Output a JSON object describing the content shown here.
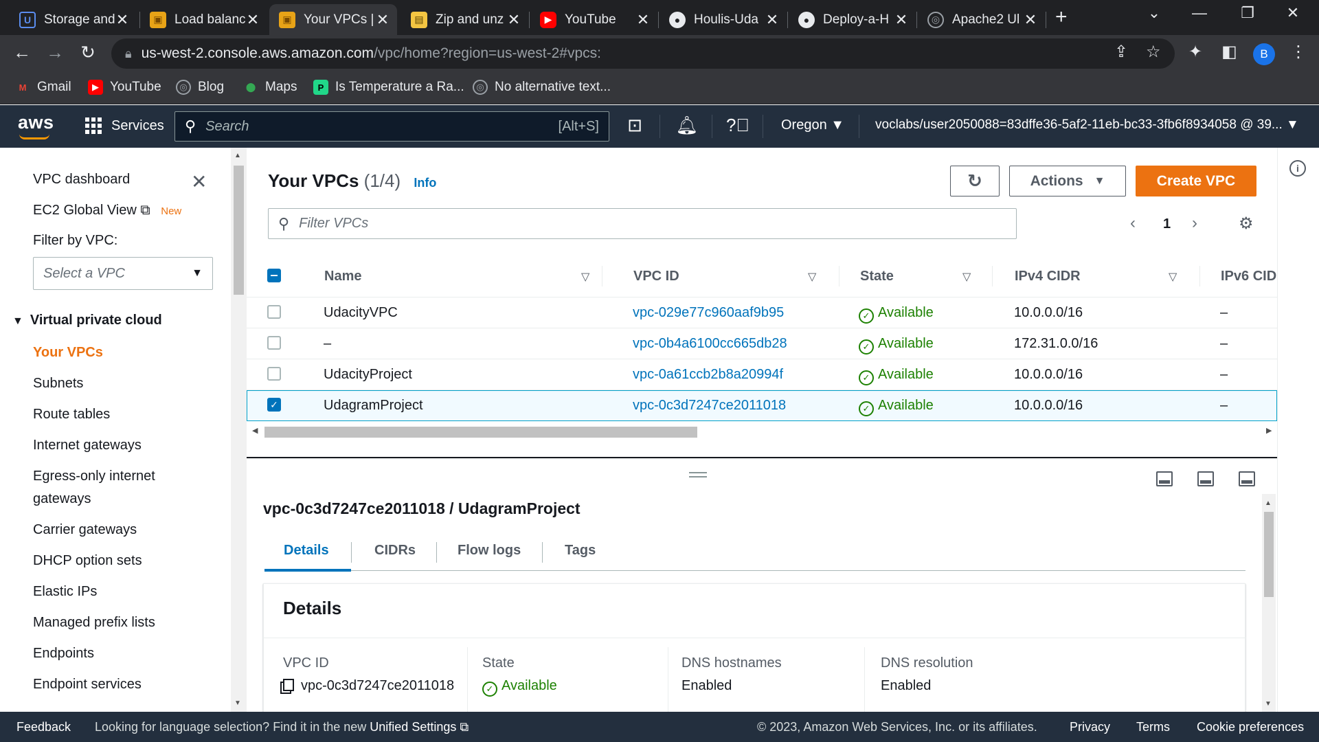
{
  "browser": {
    "tabs": [
      {
        "title": "Storage and",
        "icon": "aws-icon",
        "active": false
      },
      {
        "title": "Load balanc",
        "icon": "aws-box-icon",
        "active": false
      },
      {
        "title": "Your VPCs |",
        "icon": "aws-box-icon",
        "active": true
      },
      {
        "title": "Zip and unz",
        "icon": "page-icon",
        "active": false
      },
      {
        "title": "YouTube",
        "icon": "youtube-icon",
        "active": false
      },
      {
        "title": "Houlis-Uda",
        "icon": "github-icon",
        "active": false
      },
      {
        "title": "Deploy-a-H",
        "icon": "github-icon",
        "active": false
      },
      {
        "title": "Apache2 Ul",
        "icon": "globe-icon",
        "active": false
      }
    ],
    "url_host": "us-west-2.console.aws.amazon.com",
    "url_path": "/vpc/home?region=us-west-2#vpcs:",
    "profile_initial": "B",
    "bookmarks": [
      {
        "label": "Gmail",
        "icon": "gmail-icon"
      },
      {
        "label": "YouTube",
        "icon": "youtube-icon"
      },
      {
        "label": "Blog",
        "icon": "globe-icon"
      },
      {
        "label": "Maps",
        "icon": "maps-icon"
      },
      {
        "label": "Is Temperature a Ra...",
        "icon": "pycharm-icon"
      },
      {
        "label": "No alternative text...",
        "icon": "globe-icon"
      }
    ]
  },
  "awsnav": {
    "logo": "aws",
    "services": "Services",
    "search_placeholder": "Search",
    "search_shortcut": "[Alt+S]",
    "region": "Oregon",
    "account": "voclabs/user2050088=83dffe36-5af2-11eb-bc33-3fb6f8934058 @ 39..."
  },
  "sidebar": {
    "dashboard": "VPC dashboard",
    "ec2_global": "EC2 Global View",
    "new_badge": "New",
    "filter_label": "Filter by VPC:",
    "select_placeholder": "Select a VPC",
    "section": "Virtual private cloud",
    "items": [
      "Your VPCs",
      "Subnets",
      "Route tables",
      "Internet gateways",
      "Egress-only internet",
      "gateways",
      "Carrier gateways",
      "DHCP option sets",
      "Elastic IPs",
      "Managed prefix lists",
      "Endpoints",
      "Endpoint services"
    ]
  },
  "main": {
    "title": "Your VPCs",
    "count": "(1/4)",
    "info": "Info",
    "actions": "Actions",
    "create": "Create VPC",
    "filter_placeholder": "Filter VPCs",
    "page": "1",
    "columns": [
      "Name",
      "VPC ID",
      "State",
      "IPv4 CIDR",
      "IPv6 CID"
    ],
    "rows": [
      {
        "name": "UdacityVPC",
        "vpc_id": "vpc-029e77c960aaf9b95",
        "state": "Available",
        "cidr": "10.0.0.0/16",
        "ipv6": "–",
        "selected": false
      },
      {
        "name": "–",
        "vpc_id": "vpc-0b4a6100cc665db28",
        "state": "Available",
        "cidr": "172.31.0.0/16",
        "ipv6": "–",
        "selected": false
      },
      {
        "name": "UdacityProject",
        "vpc_id": "vpc-0a61ccb2b8a20994f",
        "state": "Available",
        "cidr": "10.0.0.0/16",
        "ipv6": "–",
        "selected": false
      },
      {
        "name": "UdagramProject",
        "vpc_id": "vpc-0c3d7247ce2011018",
        "state": "Available",
        "cidr": "10.0.0.0/16",
        "ipv6": "–",
        "selected": true
      }
    ]
  },
  "details": {
    "title": "vpc-0c3d7247ce2011018 / UdagramProject",
    "tabs": [
      "Details",
      "CIDRs",
      "Flow logs",
      "Tags"
    ],
    "card_title": "Details",
    "fields": [
      {
        "label": "VPC ID",
        "value": "vpc-0c3d7247ce2011018"
      },
      {
        "label": "State",
        "value": "Available"
      },
      {
        "label": "DNS hostnames",
        "value": "Enabled"
      },
      {
        "label": "DNS resolution",
        "value": "Enabled"
      }
    ]
  },
  "footer": {
    "feedback": "Feedback",
    "lang_text": "Looking for language selection? Find it in the new",
    "lang_link": "Unified Settings",
    "copyright": "© 2023, Amazon Web Services, Inc. or its affiliates.",
    "privacy": "Privacy",
    "terms": "Terms",
    "cookies": "Cookie preferences"
  },
  "colors": {
    "aws_nav": "#232f3e",
    "accent_orange": "#ec7211",
    "link_blue": "#0073bb",
    "success_green": "#1d8102"
  }
}
